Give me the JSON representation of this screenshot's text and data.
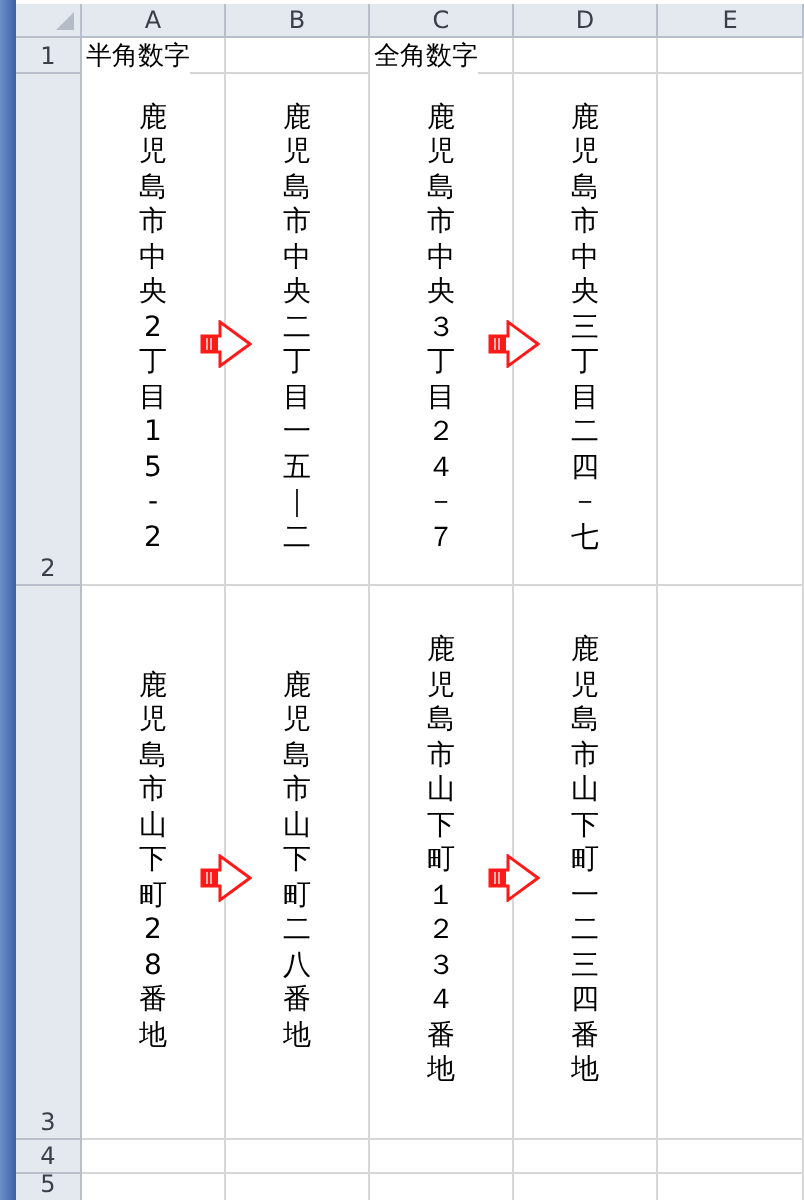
{
  "columns": [
    "A",
    "B",
    "C",
    "D",
    "E"
  ],
  "rows": [
    {
      "number": "1",
      "cells": [
        {
          "kind": "horizontal",
          "text": "半角数字"
        },
        {
          "kind": "empty"
        },
        {
          "kind": "horizontal",
          "text": "全角数字"
        },
        {
          "kind": "empty"
        },
        {
          "kind": "empty"
        }
      ]
    },
    {
      "number": "2",
      "cells": [
        {
          "kind": "vertical",
          "text": "鹿児島市中央2丁目15-2",
          "arrow_after": true
        },
        {
          "kind": "vertical",
          "text": "鹿児島市中央二丁目一五｜二"
        },
        {
          "kind": "vertical",
          "text": "鹿児島市中央３丁目２４－７",
          "arrow_after": true
        },
        {
          "kind": "vertical",
          "text": "鹿児島市中央三丁目二四－七"
        },
        {
          "kind": "empty"
        }
      ]
    },
    {
      "number": "3",
      "cells": [
        {
          "kind": "vertical",
          "text": "鹿児島市山下町28番地",
          "arrow_after": true
        },
        {
          "kind": "vertical",
          "text": "鹿児島市山下町二八番地"
        },
        {
          "kind": "vertical",
          "text": "鹿児島市山下町１２３４番地",
          "arrow_after": true
        },
        {
          "kind": "vertical",
          "text": "鹿児島市山下町一二三四番地"
        },
        {
          "kind": "empty"
        }
      ]
    },
    {
      "number": "4",
      "cells": [
        {
          "kind": "empty"
        },
        {
          "kind": "empty"
        },
        {
          "kind": "empty"
        },
        {
          "kind": "empty"
        },
        {
          "kind": "empty"
        }
      ]
    },
    {
      "number": "5",
      "cells": [
        {
          "kind": "empty"
        },
        {
          "kind": "empty"
        },
        {
          "kind": "empty"
        },
        {
          "kind": "empty"
        },
        {
          "kind": "empty"
        }
      ]
    }
  ]
}
